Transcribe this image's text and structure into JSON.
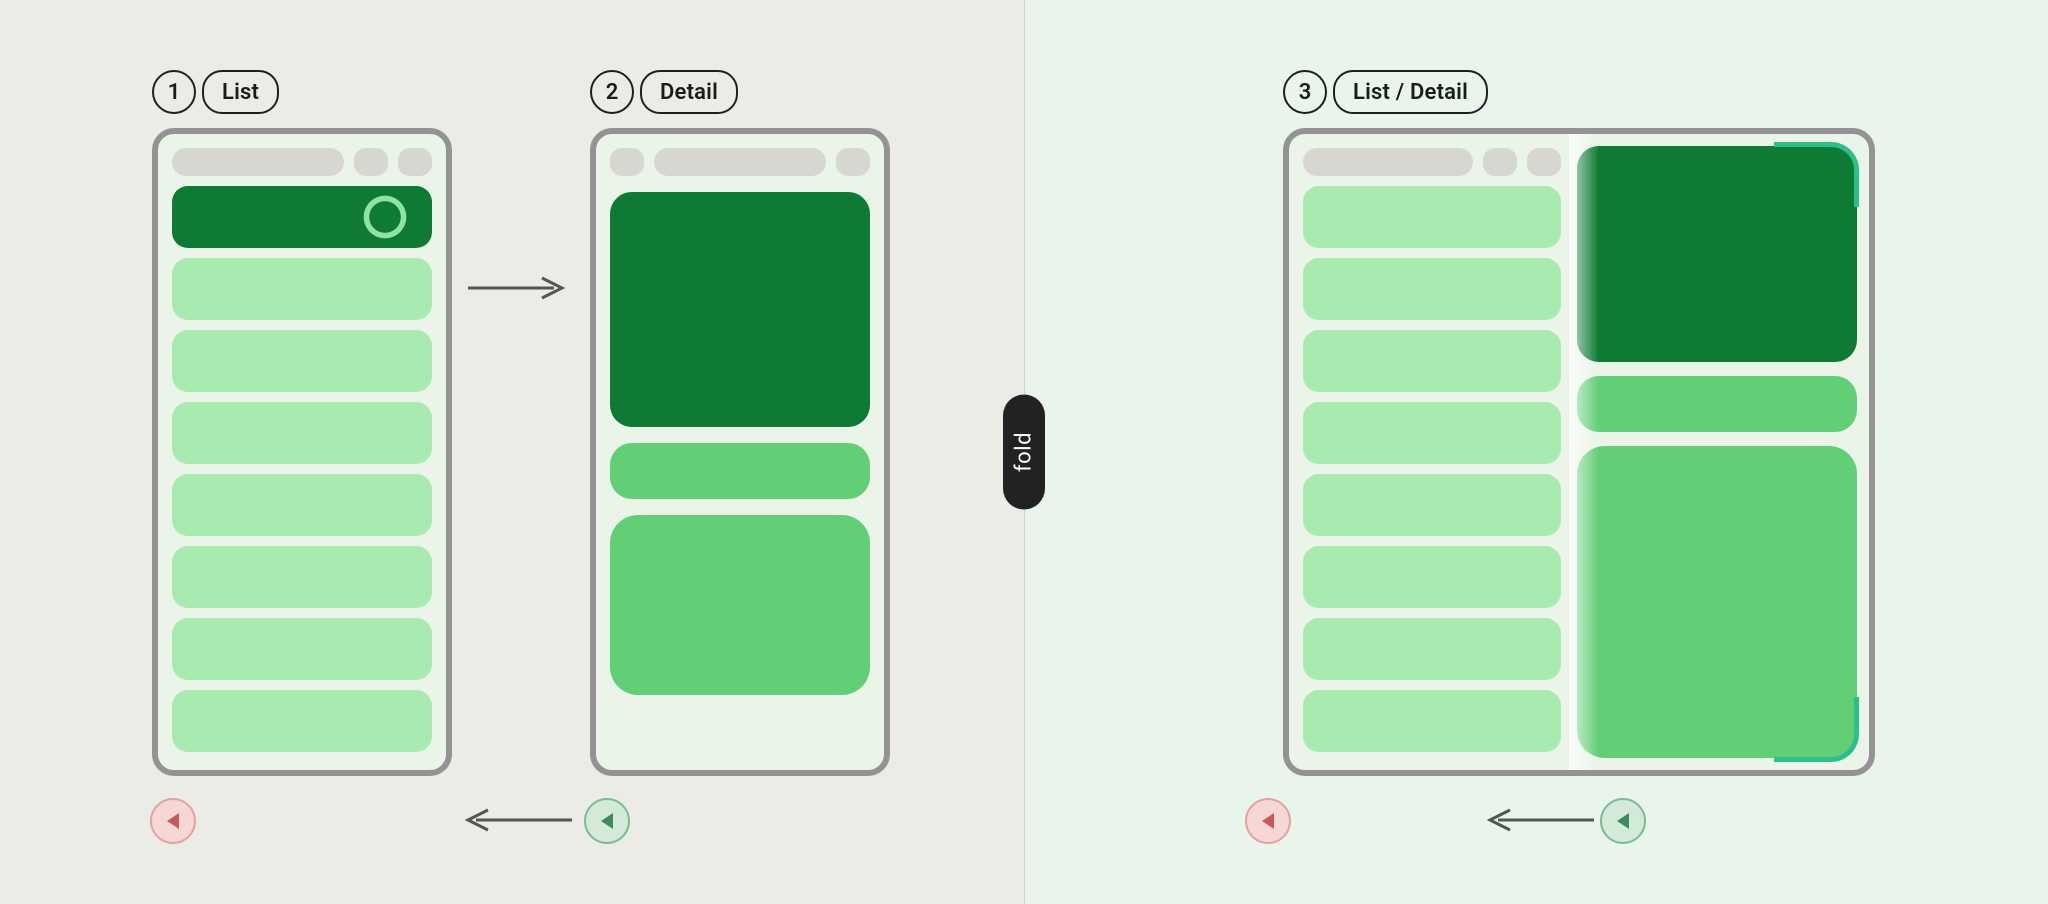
{
  "steps": {
    "one": {
      "number": "1",
      "label": "List"
    },
    "two": {
      "number": "2",
      "label": "Detail"
    },
    "three": {
      "number": "3",
      "label": "List / Detail"
    }
  },
  "fold_label": "fold"
}
